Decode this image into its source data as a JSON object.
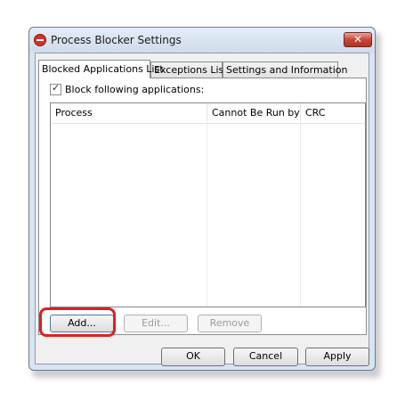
{
  "window": {
    "title": "Process Blocker Settings",
    "close_symbol": "✕",
    "title_icon": "stop-sign-icon"
  },
  "tabs": [
    {
      "label": "Blocked Applications List",
      "active": true
    },
    {
      "label": "Exceptions List",
      "active": false
    },
    {
      "label": "Settings and Information",
      "active": false
    }
  ],
  "block_checkbox": {
    "label": "Block following applications:",
    "checked": true
  },
  "list": {
    "columns": [
      "Process",
      "Cannot Be Run by",
      "CRC"
    ],
    "rows": []
  },
  "buttons": {
    "add": "Add...",
    "edit": "Edit...",
    "remove": "Remove",
    "ok": "OK",
    "cancel": "Cancel",
    "apply": "Apply"
  },
  "colors": {
    "highlight": "#e01f1f",
    "close_button": "#c8473a"
  }
}
